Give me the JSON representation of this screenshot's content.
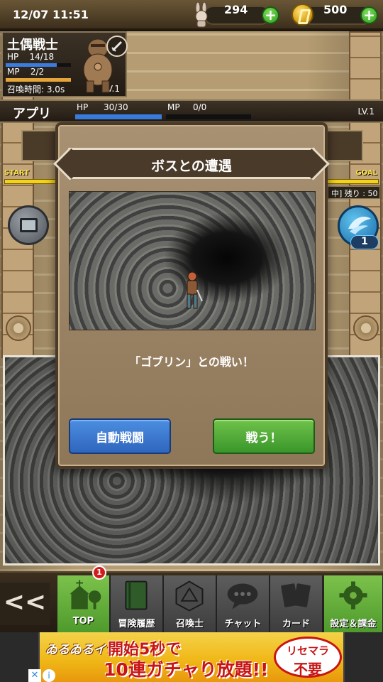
{
  "status": {
    "time": "12/07 11:51",
    "tickets": "294",
    "coins": "500"
  },
  "character": {
    "name": "土偶戦士",
    "hp_label": "HP",
    "hp_value": "14/18",
    "hp_fraction": 0.78,
    "mp_label": "MP",
    "mp_value": "2/2",
    "mp_fraction": 1.0,
    "summon_time": "召喚時間: 3.0s",
    "level": "LV.1"
  },
  "player": {
    "name": "アプリ",
    "hp_label": "HP",
    "hp_value": "30/30",
    "hp_fraction": 1.0,
    "mp_label": "MP",
    "mp_value": "0/0",
    "mp_fraction": 0.0,
    "level": "LV.1"
  },
  "progress": {
    "start": "START",
    "goal": "GOAL",
    "remaining": "中] 残り : 50"
  },
  "wing_count": "1",
  "modal": {
    "title": "ボスとの遭遇",
    "battle_text": "「ゴブリン」との戦い！",
    "auto_battle": "自動戦闘",
    "fight": "戦う！"
  },
  "nav": {
    "back": "<<",
    "badge": "1",
    "items": [
      {
        "label": "TOP",
        "icon": "church-icon"
      },
      {
        "label": "冒険履歴",
        "icon": "book-icon"
      },
      {
        "label": "召喚士",
        "icon": "d20-icon"
      },
      {
        "label": "チャット",
        "icon": "chat-icon"
      },
      {
        "label": "カード",
        "icon": "cards-icon"
      },
      {
        "label": "設定＆課金",
        "icon": "gear-icon"
      }
    ]
  },
  "ad": {
    "logo": "ゐるゐるイデア",
    "line1": "開始5秒で",
    "line2": "10連ガチャり放題!!",
    "badge_line1": "リセマラ",
    "badge_line2": "不要"
  },
  "colors": {
    "hp": "#3a7ce0",
    "mp": "#e4a53a",
    "accent_green": "#4e9a2c",
    "accent_blue": "#2f66be",
    "progress": "#f3d21c"
  }
}
